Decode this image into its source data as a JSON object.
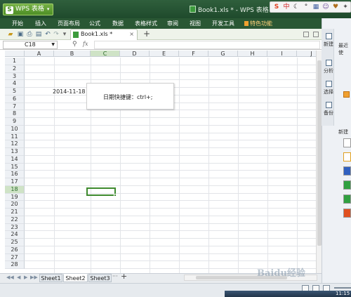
{
  "app": {
    "button_label": "WPS 表格",
    "logo_glyph": "S",
    "window_title": "Book1.xls * - WPS 表格"
  },
  "menu": [
    {
      "label": "开始"
    },
    {
      "label": "插入"
    },
    {
      "label": "页面布局"
    },
    {
      "label": "公式"
    },
    {
      "label": "数据"
    },
    {
      "label": "表格样式"
    },
    {
      "label": "审阅"
    },
    {
      "label": "视图"
    },
    {
      "label": "开发工具"
    },
    {
      "label": "特色功能"
    }
  ],
  "document_tab": {
    "label": "Book1.xls *",
    "close_glyph": "×",
    "new_tab_glyph": "+"
  },
  "formula_bar": {
    "name_box": "C18",
    "fx_label": "fx",
    "value": ""
  },
  "grid": {
    "columns": [
      "A",
      "B",
      "C",
      "D",
      "E",
      "F",
      "G",
      "H",
      "I",
      "J"
    ],
    "active_column": "C",
    "rows": [
      "1",
      "2",
      "3",
      "4",
      "5",
      "6",
      "7",
      "8",
      "9",
      "10",
      "11",
      "12",
      "13",
      "14",
      "15",
      "16",
      "17",
      "18",
      "19",
      "20",
      "21",
      "22",
      "23",
      "24",
      "25",
      "26",
      "27",
      "28"
    ],
    "active_row": "18",
    "cell_b5": "2014-11-18",
    "textbox_text": "日期快捷键：ctrl+;"
  },
  "sheets": {
    "tabs": [
      "Sheet1",
      "Sheet2",
      "Sheet3"
    ],
    "active": "Sheet2",
    "more_glyph": "···",
    "add_glyph": "+"
  },
  "right_pane": {
    "buttons": [
      "新建",
      "分析",
      "选择",
      "备份"
    ],
    "title": "最近使",
    "new_label": "新建"
  },
  "status": {
    "clock": "11:15",
    "watermark": "Baidu经验"
  },
  "colors": {
    "title_bar": "#2f5f3c",
    "app_button": "#5a9a30",
    "selection": "#3e8a2e"
  },
  "icons": [
    "open-folder-icon",
    "save-icon",
    "print-icon",
    "print-preview-icon",
    "undo-icon",
    "redo-icon",
    "zoom-icon",
    "document-icon"
  ]
}
